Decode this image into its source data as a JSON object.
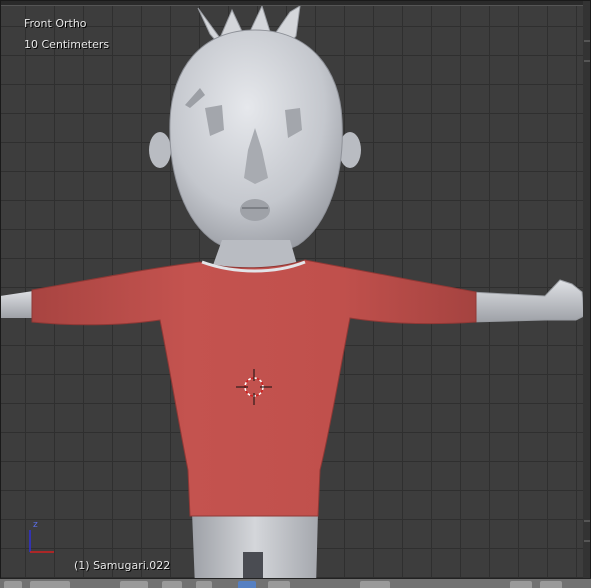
{
  "viewport": {
    "view_name": "Front Ortho",
    "unit_scale": "10 Centimeters",
    "object_name": "(1) Samugari.022"
  },
  "gizmo": {
    "z_label": "z",
    "x_color": "#d02020",
    "z_color": "#3030d8"
  },
  "colors": {
    "background": "#3d3d3d",
    "grid_line": "#2f2f2f",
    "shirt": "#c05550",
    "skin": "#c8ccd2",
    "header_active": "#5680c2"
  },
  "icons": [
    "axis-gizmo-icon",
    "3d-cursor-icon"
  ]
}
